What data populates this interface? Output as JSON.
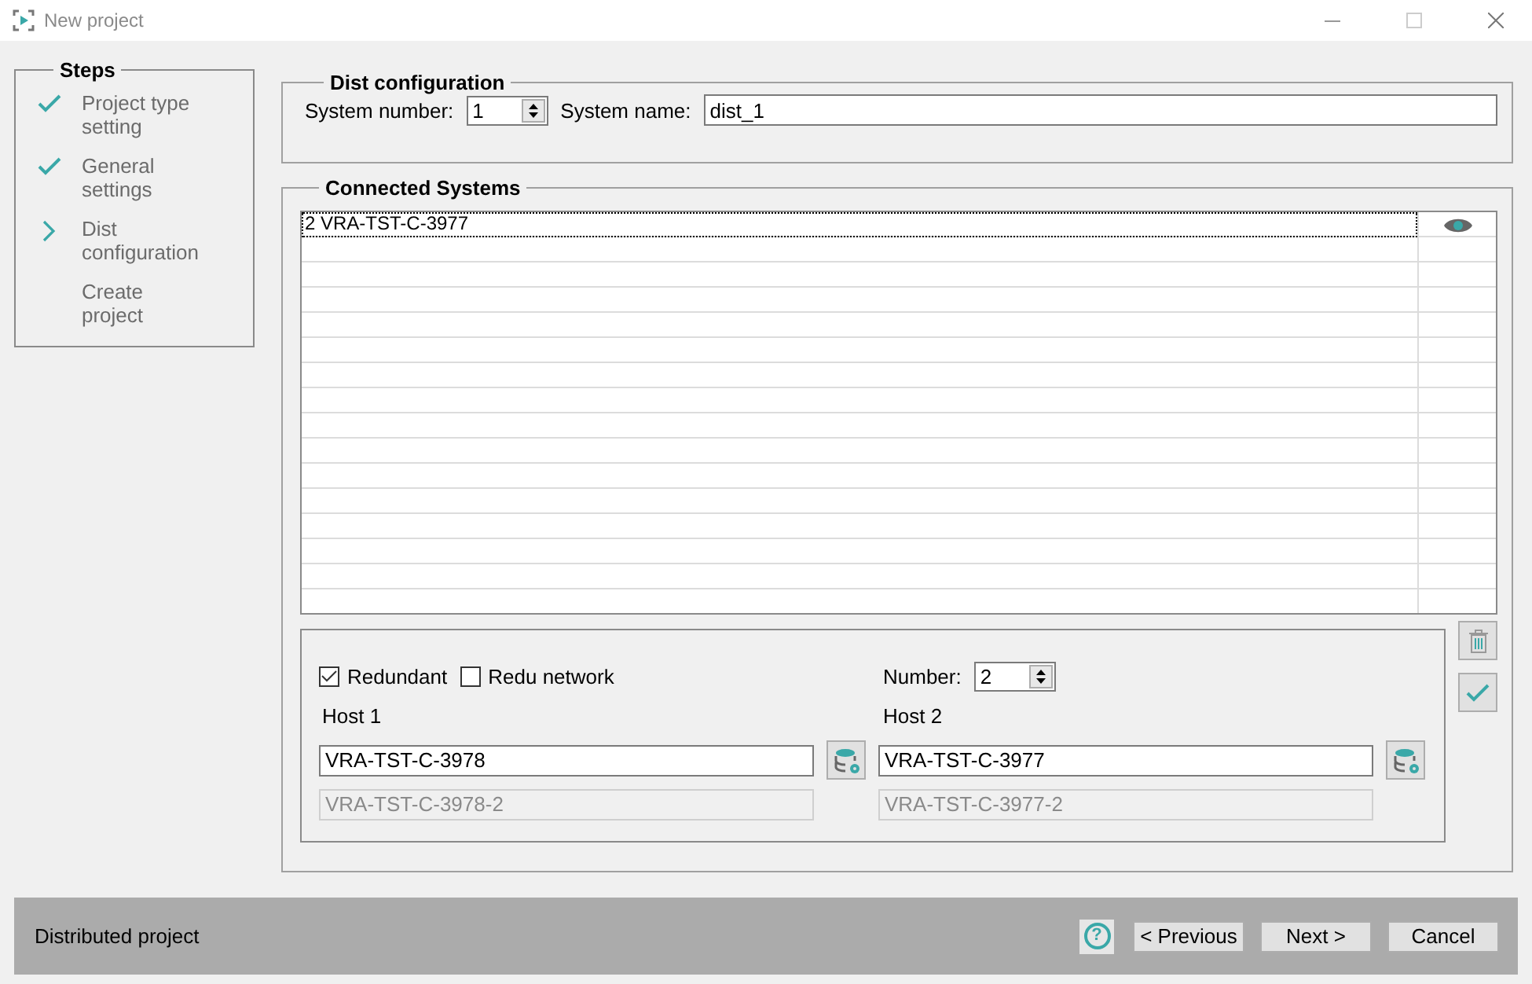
{
  "window": {
    "title": "New project"
  },
  "steps": {
    "title": "Steps",
    "items": [
      {
        "label": "Project type setting",
        "kind": "done"
      },
      {
        "label": "General settings",
        "kind": "done"
      },
      {
        "label": "Dist configuration",
        "kind": "current"
      },
      {
        "label": "Create project",
        "kind": "pending"
      }
    ]
  },
  "dist_configuration": {
    "title": "Dist configuration",
    "system_number_label": "System number:",
    "system_number": "1",
    "system_name_label": "System name:",
    "system_name": "dist_1"
  },
  "connected_systems": {
    "title": "Connected Systems",
    "rows": [
      {
        "text": "2 VRA-TST-C-3977",
        "selected": true
      }
    ],
    "redundant": {
      "label": "Redundant",
      "checked": true
    },
    "redu_network": {
      "label": "Redu network",
      "checked": false
    },
    "number_label": "Number:",
    "number": "2",
    "hosts": [
      {
        "label": "Host 1",
        "value": "VRA-TST-C-3978",
        "redundant_value": "VRA-TST-C-3978-2"
      },
      {
        "label": "Host 2",
        "value": "VRA-TST-C-3977",
        "redundant_value": "VRA-TST-C-3977-2"
      }
    ]
  },
  "footer": {
    "status": "Distributed project",
    "help": "?",
    "buttons": [
      "< Previous",
      "Next >",
      "Cancel"
    ]
  }
}
